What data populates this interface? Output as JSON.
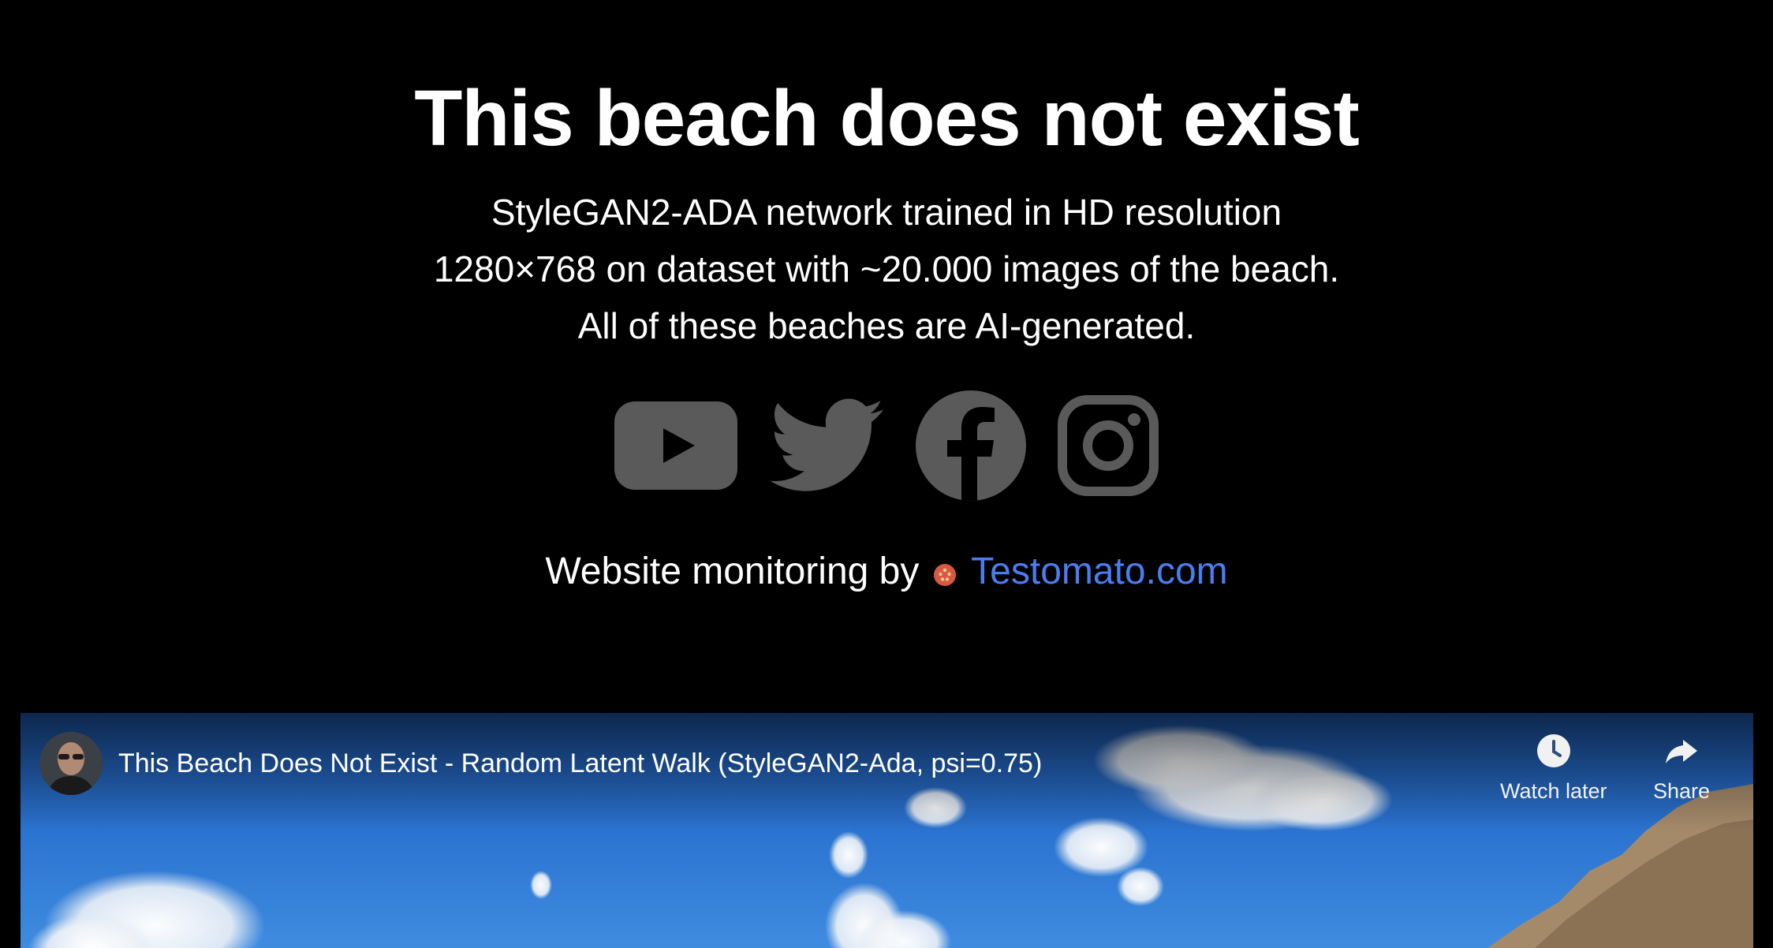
{
  "header": {
    "title": "This beach does not exist",
    "subtitle_lines": [
      "StyleGAN2-ADA network trained in HD resolution",
      "1280×768 on dataset with ~20.000 images of the beach.",
      "All of these beaches are AI-generated."
    ]
  },
  "socials": [
    {
      "name": "youtube-icon"
    },
    {
      "name": "twitter-icon"
    },
    {
      "name": "facebook-icon"
    },
    {
      "name": "instagram-icon"
    }
  ],
  "monitoring": {
    "prefix": "Website monitoring by",
    "link_text": "Testomato.com"
  },
  "video": {
    "title": "This Beach Does Not Exist - Random Latent Walk (StyleGAN2-Ada, psi=0.75)",
    "watch_later_label": "Watch later",
    "share_label": "Share"
  },
  "colors": {
    "background": "#000000",
    "icon_gray": "#5a5a5a",
    "link_blue": "#4a7df0",
    "tomato": "#d9593e"
  }
}
